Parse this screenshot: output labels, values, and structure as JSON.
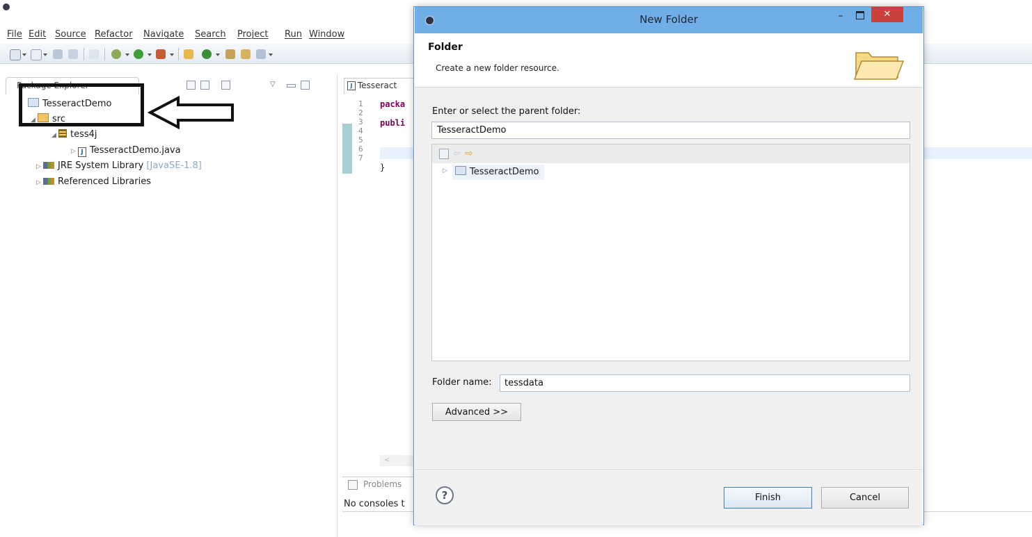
{
  "menubar": {
    "items": [
      "File",
      "Edit",
      "Source",
      "Refactor",
      "Navigate",
      "Search",
      "Project",
      "Run",
      "Window"
    ]
  },
  "package_explorer": {
    "tab_label": "Package Explorer",
    "tree": {
      "project": "TesseractDemo",
      "src": "src",
      "package": "tess4j",
      "file": "TesseractDemo.java",
      "jre_label": "JRE System Library",
      "jre_version": "[JavaSE-1.8]",
      "referenced": "Referenced Libraries"
    }
  },
  "editor": {
    "tab_label": "Tesseract",
    "line_numbers": [
      "1",
      "2",
      "3",
      "4",
      "5",
      "6",
      "7"
    ],
    "lines": {
      "l1": "packa",
      "l3": "publi",
      "l6": "}"
    },
    "scroll_glyph": "<"
  },
  "bottom": {
    "problems_label": "Problems",
    "console_text": "No consoles t"
  },
  "dialog": {
    "title": "New Folder",
    "header_title": "Folder",
    "header_subtitle": "Create a new folder resource.",
    "parent_label": "Enter or select the parent folder:",
    "parent_value": "TesseractDemo",
    "tree_item": "TesseractDemo",
    "folder_name_label": "Folder name:",
    "folder_name_value": "tessdata",
    "advanced_label": "Advanced >>",
    "help_label": "?",
    "finish_label": "Finish",
    "cancel_label": "Cancel",
    "minimize_glyph": "–",
    "close_glyph": "✕"
  },
  "colors": {
    "dialog_title_bar": "#6faee7",
    "close_button": "#c9413a",
    "keyword": "#7f0055",
    "annotation": "#111111"
  },
  "icons": [
    "eclipse-logo-icon",
    "folder-icon",
    "package-icon",
    "java-file-icon",
    "library-icon",
    "home-icon",
    "back-arrow-icon",
    "forward-arrow-icon",
    "help-icon",
    "left-arrow-annotation-icon"
  ]
}
